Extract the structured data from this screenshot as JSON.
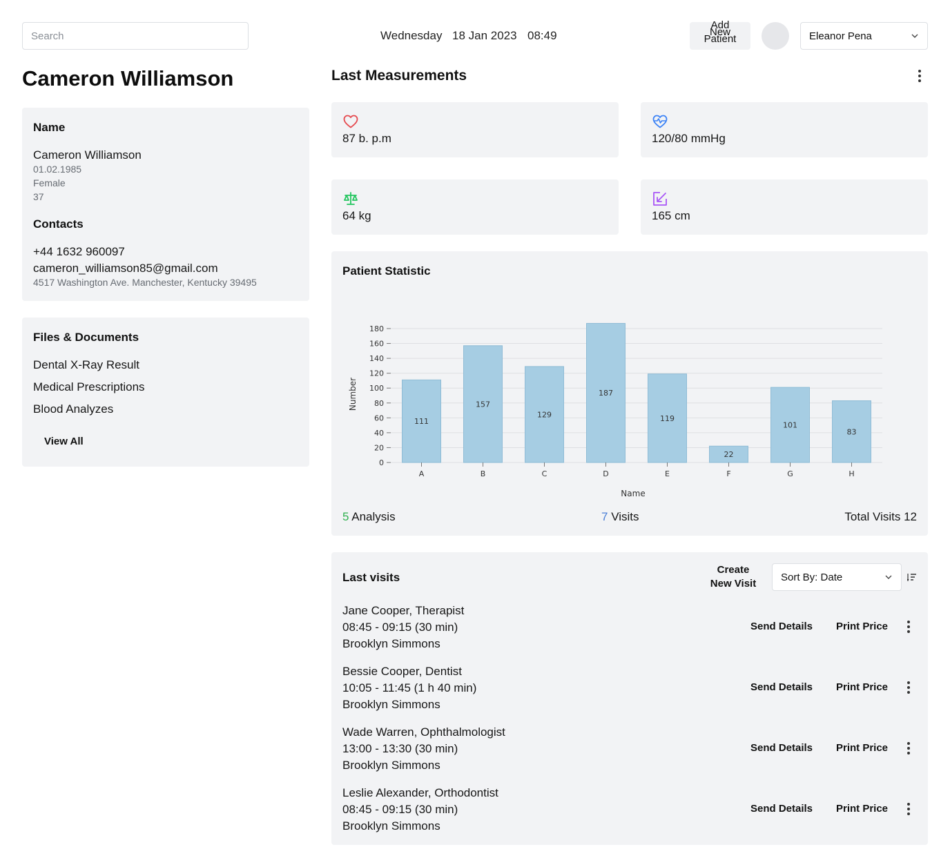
{
  "header": {
    "search_placeholder": "Search",
    "day": "Wednesday",
    "date": "18 Jan 2023",
    "time": "08:49",
    "add_patient_lines": [
      "Add",
      "New",
      "Patient"
    ],
    "user_name": "Eleanor Pena"
  },
  "patient": {
    "title": "Cameron Williamson",
    "name_heading": "Name",
    "name": "Cameron Williamson",
    "dob": "01.02.1985",
    "gender": "Female",
    "age": "37",
    "contacts_heading": "Contacts",
    "phone": "+44 1632 960097",
    "email": "cameron_williamson85@gmail.com",
    "address": "4517 Washington Ave. Manchester, Kentucky 39495"
  },
  "files": {
    "heading": "Files & Documents",
    "items": [
      "Dental X-Ray Result",
      "Medical Prescriptions",
      "Blood Analyzes"
    ],
    "view_all": "View All"
  },
  "measurements": {
    "title": "Last Measurements",
    "items": [
      {
        "icon": "heart-icon",
        "value": "87 b. p.m",
        "color": "#e5484d"
      },
      {
        "icon": "heart-pulse-icon",
        "value": "120/80 mmHg",
        "color": "#3b82f6"
      },
      {
        "icon": "scale-icon",
        "value": "64 kg",
        "color": "#22c55e"
      },
      {
        "icon": "arrow-expand-icon",
        "value": "165 cm",
        "color": "#a855f7"
      }
    ]
  },
  "statistic": {
    "title": "Patient Statistic",
    "analysis_count": "5",
    "analysis_label": "Analysis",
    "visits_count": "7",
    "visits_label": "Visits",
    "total_visits": "Total Visits 12"
  },
  "chart_data": {
    "type": "bar",
    "categories": [
      "A",
      "B",
      "C",
      "D",
      "E",
      "F",
      "G",
      "H"
    ],
    "values": [
      111,
      157,
      129,
      187,
      119,
      22,
      101,
      83
    ],
    "title": "",
    "xlabel": "Name",
    "ylabel": "Number",
    "ylim": [
      0,
      180
    ],
    "yticks": [
      0,
      20,
      40,
      60,
      80,
      100,
      120,
      140,
      160,
      180
    ],
    "grid": true,
    "bar_color": "#a6cde3",
    "bar_stroke": "#8fbcd6"
  },
  "visits": {
    "title": "Last visits",
    "create_lines": [
      "Create",
      "New Visit"
    ],
    "sort_label": "Sort By: Date",
    "send_label": "Send Details",
    "print_label": "Print Price",
    "items": [
      {
        "doctor": "Jane Cooper, Therapist",
        "time": "08:45 - 09:15 (30 min)",
        "patient": "Brooklyn Simmons"
      },
      {
        "doctor": "Bessie Cooper, Dentist",
        "time": "10:05 - 11:45 (1 h 40 min)",
        "patient": "Brooklyn Simmons"
      },
      {
        "doctor": "Wade Warren, Ophthalmologist",
        "time": "13:00 - 13:30 (30 min)",
        "patient": "Brooklyn Simmons"
      },
      {
        "doctor": "Leslie Alexander, Orthodontist",
        "time": "08:45 - 09:15 (30 min)",
        "patient": "Brooklyn Simmons"
      }
    ]
  }
}
